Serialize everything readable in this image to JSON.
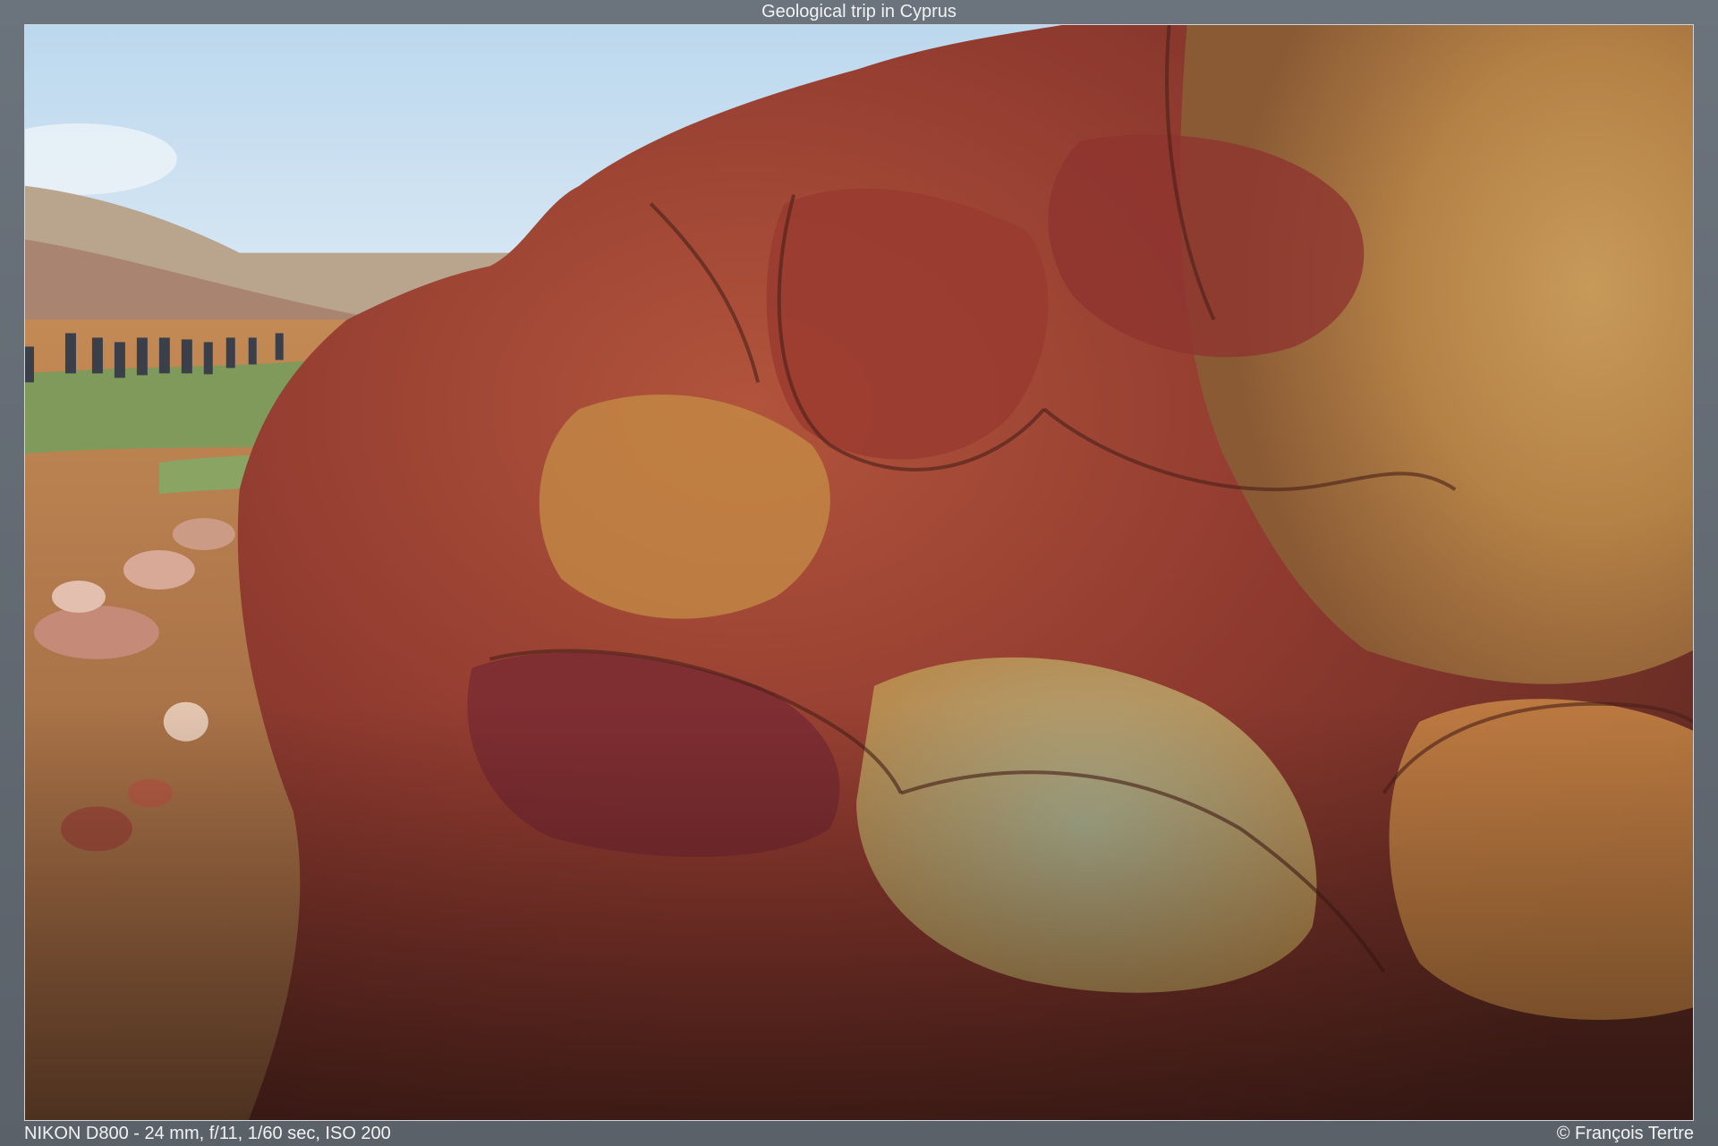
{
  "title": "Geological trip in Cyprus",
  "exif": "NIKON D800 - 24 mm, f/11, 1/60 sec, ISO 200",
  "credit": "© François Tertre",
  "photo": {
    "subject": "outcrop-photo",
    "colors": {
      "sky": "#d6e6f2",
      "rock_red": "#8c2f2a",
      "rock_ochre": "#c9913f",
      "rock_green": "#9aa58a",
      "ground": "#b77a4a",
      "grass": "#7f9a5a"
    }
  }
}
